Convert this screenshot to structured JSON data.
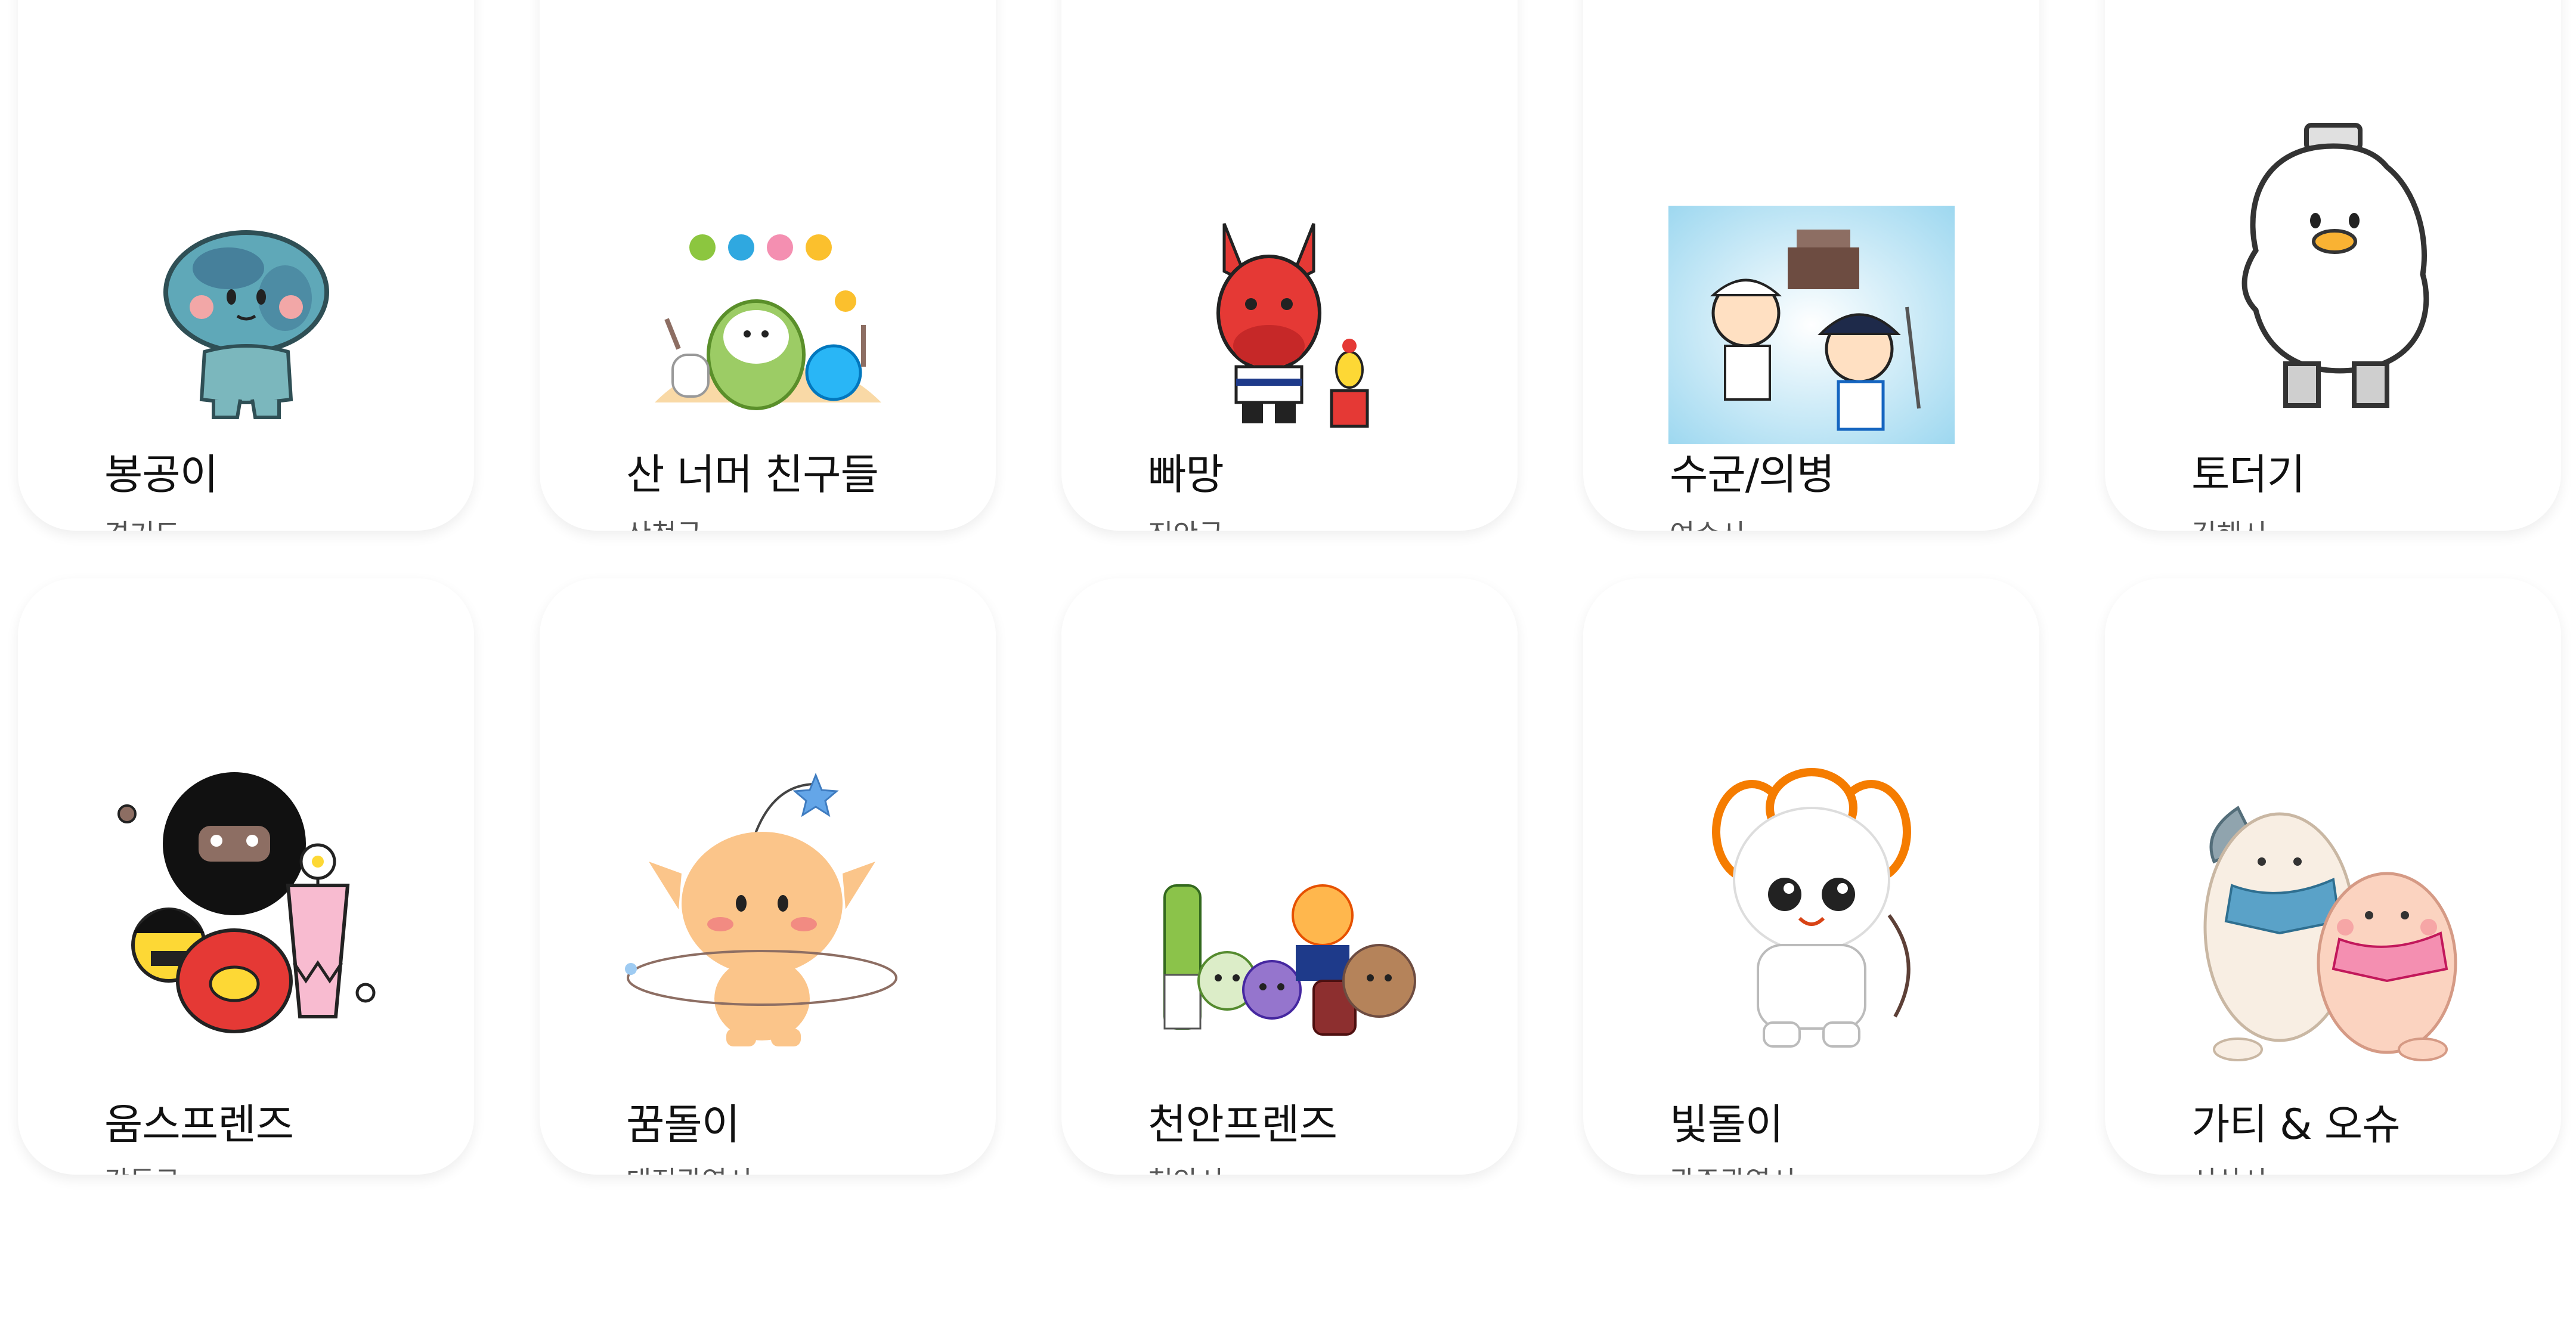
{
  "cards": [
    {
      "name": "봉공이",
      "region": "경기도",
      "image": "mascot-bonggong-illustration"
    },
    {
      "name": "산 너머 친구들",
      "region": "산청군",
      "image": "mascot-san-friends-illustration"
    },
    {
      "name": "빠망",
      "region": "진안군",
      "image": "mascot-ppamang-illustration"
    },
    {
      "name": "수군/의병",
      "region": "여수시",
      "image": "mascot-sugun-uibyeong-illustration"
    },
    {
      "name": "토더기",
      "region": "김해시",
      "image": "mascot-todeogi-illustration"
    },
    {
      "name": "움스프렌즈",
      "region": "강동구",
      "image": "mascot-ums-friends-illustration"
    },
    {
      "name": "꿈돌이",
      "region": "대전광역시",
      "image": "mascot-kkumdori-illustration"
    },
    {
      "name": "천안프렌즈",
      "region": "천안시",
      "image": "mascot-cheonan-friends-illustration"
    },
    {
      "name": "빛돌이",
      "region": "광주광역시",
      "image": "mascot-bitdori-illustration"
    },
    {
      "name": "가티 & 오슈",
      "region": "서산시",
      "image": "mascot-gati-osyu-illustration"
    }
  ]
}
